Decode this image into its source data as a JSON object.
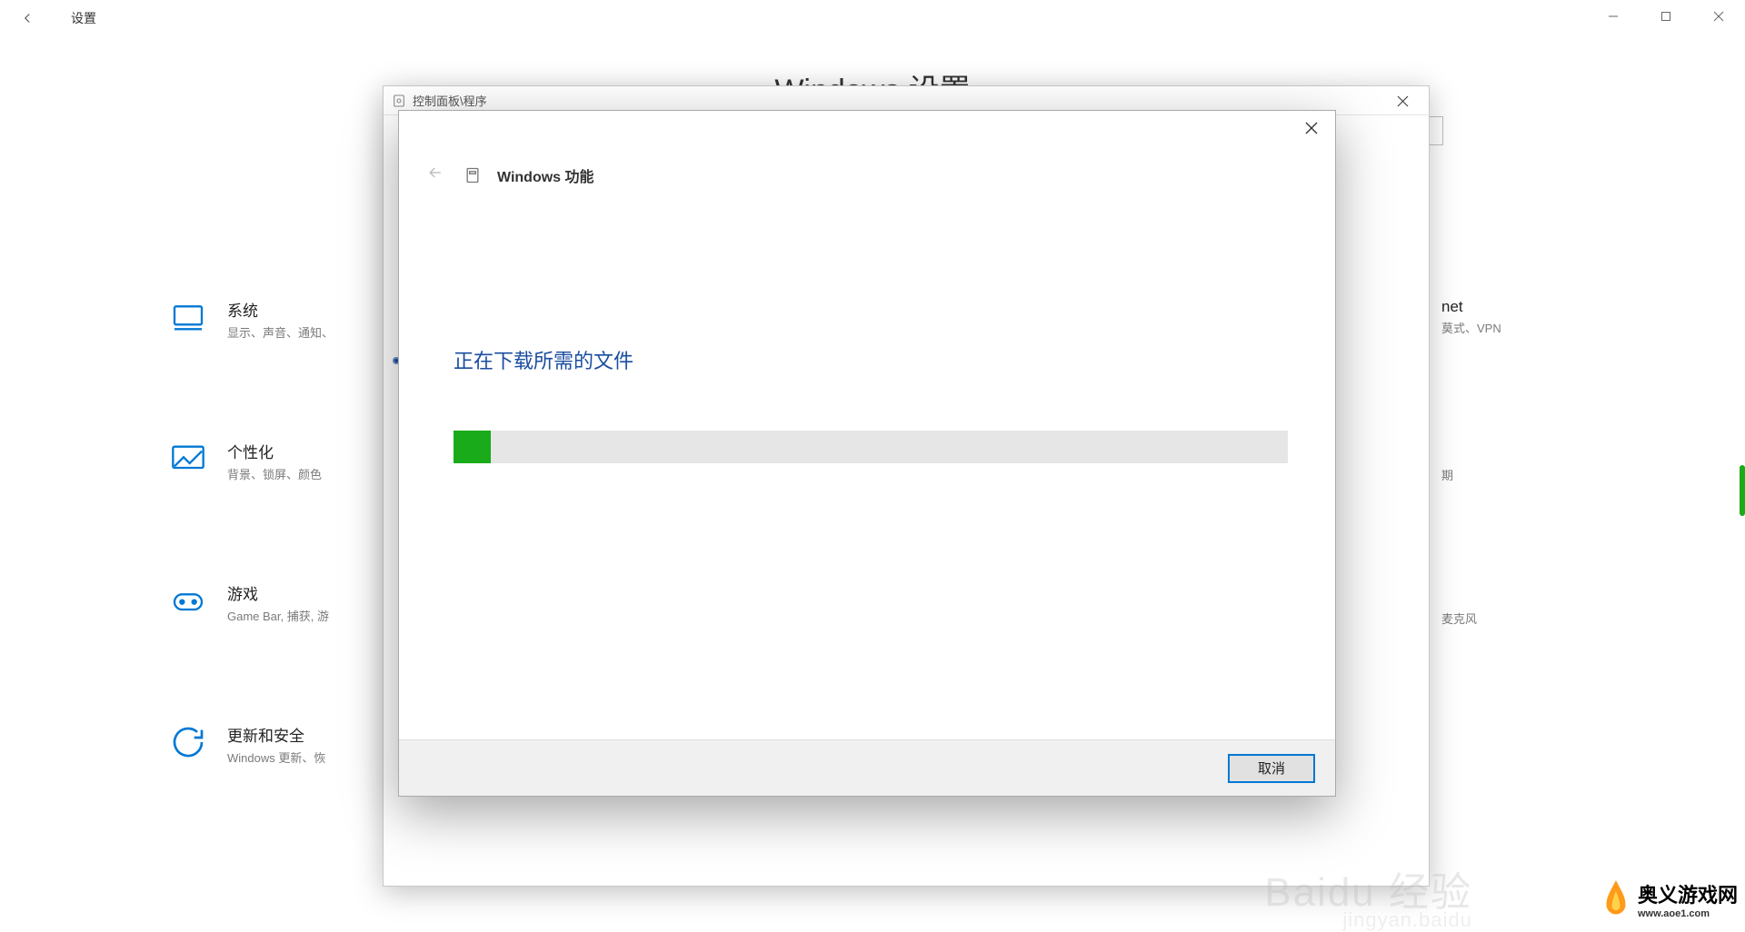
{
  "settings": {
    "title": "设置",
    "page_header": "Windows 设置",
    "categories": [
      {
        "key": "system",
        "title": "系统",
        "sub": "显示、声音、通知、"
      },
      {
        "key": "personalization",
        "title": "个性化",
        "sub": "背景、锁屏、颜色"
      },
      {
        "key": "gaming",
        "title": "游戏",
        "sub": "Game Bar, 捕获, 游"
      },
      {
        "key": "update",
        "title": "更新和安全",
        "sub": "Windows 更新、恢"
      }
    ],
    "right_fragments": [
      {
        "title": "net",
        "sub": "莫式、VPN"
      },
      {
        "title": "",
        "sub": "期"
      },
      {
        "title": "",
        "sub": "麦克风"
      }
    ]
  },
  "cp_window": {
    "title": "控制面板\\程序"
  },
  "dialog": {
    "title": "Windows 功能",
    "status": "正在下载所需的文件",
    "progress_percent": 4.5,
    "cancel_label": "取消"
  },
  "watermark": {
    "main": "Baidu 经验",
    "sub": "jingyan.baidu"
  },
  "sitebrand": {
    "name": "奥义游戏网",
    "url": "www.aoe1.com"
  }
}
